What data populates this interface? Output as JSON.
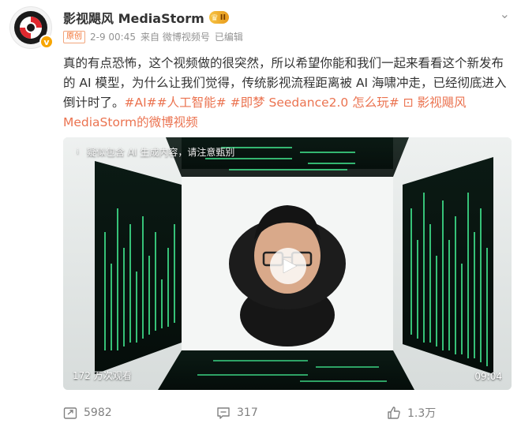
{
  "author": {
    "name": "影视飓风 MediaStorm",
    "vip_badge": "II",
    "verified_icon": "v-badge-icon"
  },
  "meta": {
    "original_badge": "原创",
    "time": "2-9 00:45",
    "source": "来自 微博视频号",
    "edited": "已编辑"
  },
  "post": {
    "text_main": "真的有点恐怖，这个视频做的很突然，所以希望你能和我们一起来看看这个新发布的 AI 模型，为什么让我们觉得，传统影视流程距离被 AI 海啸冲走，已经彻底进入倒计时了。",
    "tag_ai": "#AI#",
    "tag_artificial_intelligence": "#人工智能#",
    "tag_seedance": "#即梦 Seedance2.0 怎么玩#",
    "video_link": "影视飓风 MediaStorm的微博视频"
  },
  "video": {
    "ai_notice": "疑似包含 AI 生成内容，请注意甄别",
    "views": "172 万次观看",
    "duration": "09:04"
  },
  "actions": {
    "repost": "5982",
    "comment": "317",
    "like": "1.3万"
  }
}
